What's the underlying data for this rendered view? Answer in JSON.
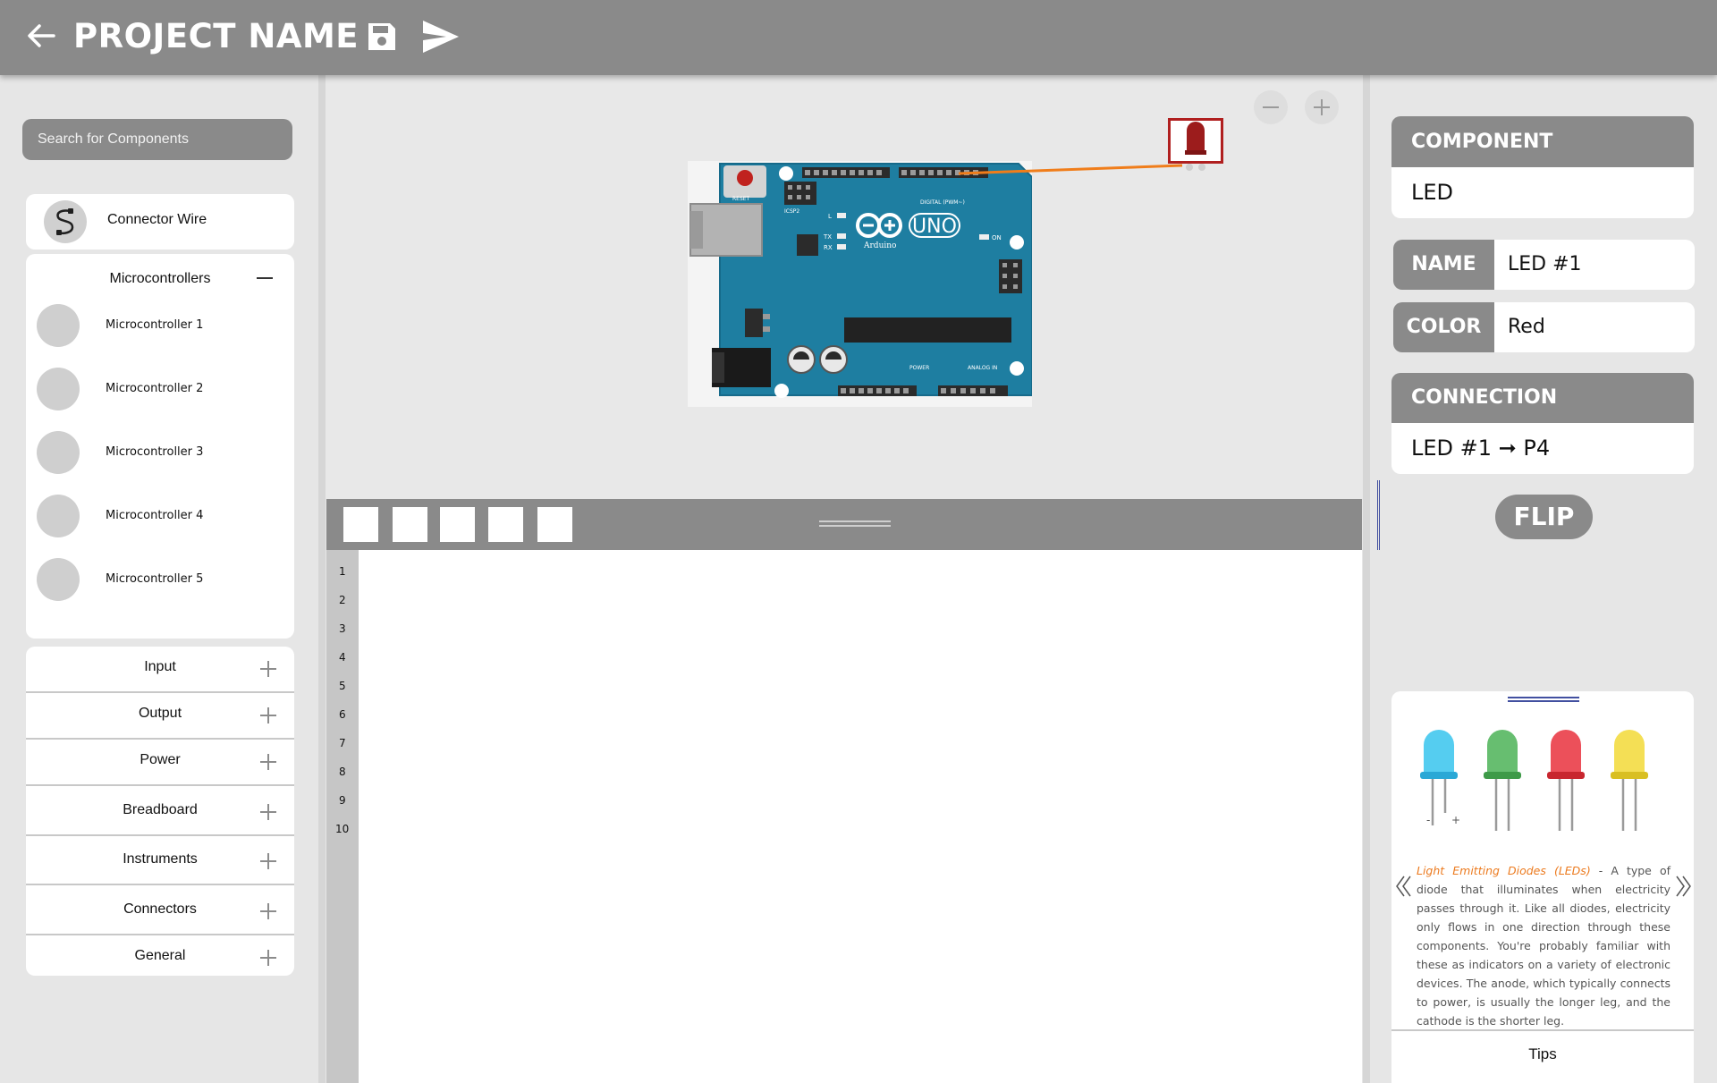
{
  "header": {
    "title": "PROJECT NAME",
    "icons": [
      "back-arrow-icon",
      "save-icon",
      "send-icon"
    ]
  },
  "sidebar": {
    "search_placeholder": "Search for Components",
    "connector_wire": "Connector Wire",
    "microcontrollers": {
      "title": "Microcontrollers",
      "items": [
        "Microcontroller 1",
        "Microcontroller 2",
        "Microcontroller 3",
        "Microcontroller 4",
        "Microcontroller 5"
      ]
    },
    "categories": [
      "Input",
      "Output",
      "Power",
      "Breadboard",
      "Instruments",
      "Connectors",
      "General"
    ]
  },
  "workspace": {
    "board": {
      "brand": "Arduino",
      "model": "UNO",
      "reset_label": "RESET",
      "on_label": "ON",
      "icsp_label": "ICSP2",
      "digital_label": "DIGITAL (PWM~)",
      "power_label": "POWER",
      "analog_label": "ANALOG IN",
      "l_label": "L",
      "tx_label": "TX",
      "rx_label": "RX"
    }
  },
  "editor": {
    "line_numbers": [
      "1",
      "2",
      "3",
      "4",
      "5",
      "6",
      "7",
      "8",
      "9",
      "10"
    ]
  },
  "properties": {
    "component_header": "COMPONENT",
    "component_value": "LED",
    "name_label": "NAME",
    "name_value": "LED #1",
    "color_label": "COLOR",
    "color_value": "Red",
    "connection_header": "CONNECTION",
    "connection_value": "LED #1 ➞  P4",
    "flip_label": "FLIP"
  },
  "info": {
    "polarity_minus": "-",
    "polarity_plus": "+",
    "term": "Light Emitting Diodes (LEDs)",
    "description": " - A type of diode that illuminates when electricity passes through it. Like all diodes, electricity only flows in one direction through these components. You're probably familiar with these as indicators on a variety of electronic devices. The anode, which typically connects to power, is usually the longer leg, and the cathode is the shorter leg.",
    "tips_label": "Tips"
  },
  "colors": {
    "bar_gray": "#8a8a8a",
    "board_blue": "#1e7ea1",
    "wire_orange": "#f07d1a",
    "led_red": "#9c1c1c",
    "info_orange": "#ec7a1e"
  }
}
